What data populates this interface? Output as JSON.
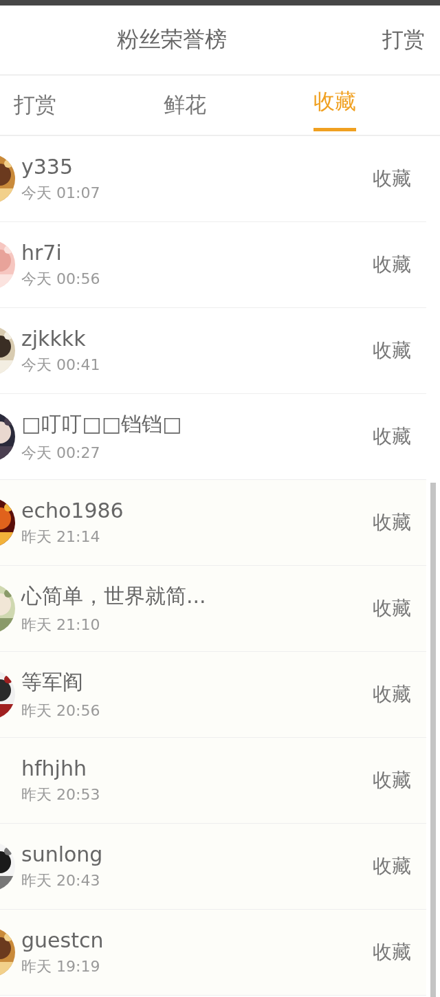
{
  "header": {
    "title": "粉丝荣誉榜",
    "action": "打赏"
  },
  "tabs": [
    {
      "label": "打赏",
      "selected": false
    },
    {
      "label": "鲜花",
      "selected": false
    },
    {
      "label": "收藏",
      "selected": true
    }
  ],
  "rows": [
    {
      "name": "y335",
      "time": "今天 01:07",
      "action": "收藏"
    },
    {
      "name": "hr7i",
      "time": "今天 00:56",
      "action": "收藏"
    },
    {
      "name": "zjkkkk",
      "time": "今天 00:41",
      "action": "收藏"
    },
    {
      "name": "□叮叮□□铛铛□",
      "time": "今天 00:27",
      "action": "收藏"
    },
    {
      "name": "echo1986",
      "time": "昨天 21:14",
      "action": "收藏"
    },
    {
      "name": "心简单，世界就简...",
      "time": "昨天 21:10",
      "action": "收藏"
    },
    {
      "name": "等军阎",
      "time": "昨天 20:56",
      "action": "收藏"
    },
    {
      "name": "hfhjhh",
      "time": "昨天 20:53",
      "action": "收藏"
    },
    {
      "name": "sunlong",
      "time": "昨天 20:43",
      "action": "收藏"
    },
    {
      "name": "guestcn",
      "time": "昨天 19:19",
      "action": "收藏"
    }
  ]
}
